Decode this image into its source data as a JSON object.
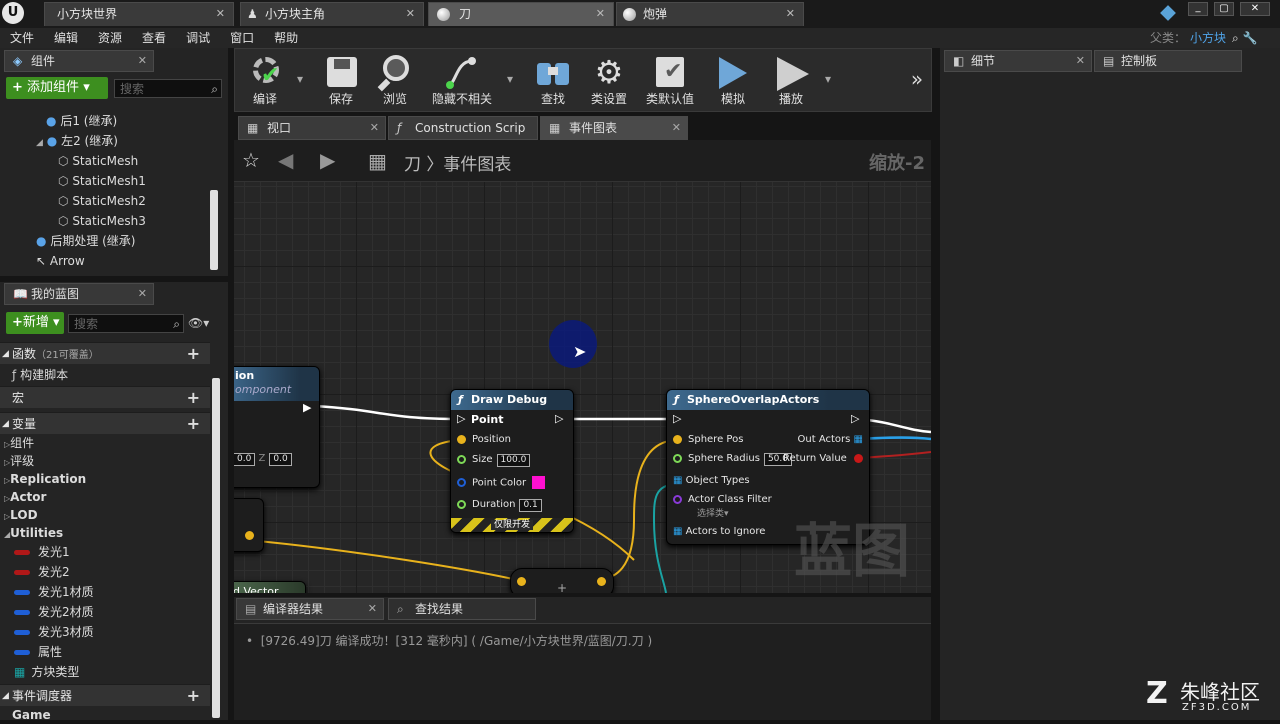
{
  "doc_tabs": [
    {
      "label": "小方块世界",
      "active": false
    },
    {
      "label": "小方块主角",
      "active": false
    },
    {
      "label": "刀",
      "active": true
    },
    {
      "label": "炮弹",
      "active": false
    }
  ],
  "window": {
    "parent_label": "父类：",
    "parent_value": "小方块"
  },
  "menu": [
    "文件",
    "编辑",
    "资源",
    "查看",
    "调试",
    "窗口",
    "帮助"
  ],
  "components": {
    "tab": "组件",
    "add_button": "添加组件",
    "search_placeholder": "搜索",
    "tree": [
      "后1 (继承)",
      "左2 (继承)",
      "StaticMesh",
      "StaticMesh1",
      "StaticMesh2",
      "StaticMesh3",
      "后期处理 (继承)",
      "Arrow"
    ]
  },
  "myblueprint": {
    "tab": "我的蓝图",
    "new_button": "新增",
    "search_placeholder": "搜索",
    "functions_label": "函数",
    "functions_count": "（21可覆盖）",
    "construct_script": "构建脚本",
    "macros_label": "宏",
    "variables_label": "变量",
    "categories": [
      "组件",
      "评级",
      "Replication",
      "Actor",
      "LOD",
      "Utilities"
    ],
    "variables": [
      {
        "name": "发光1",
        "color": "#b01818"
      },
      {
        "name": "发光2",
        "color": "#b01818"
      },
      {
        "name": "发光1材质",
        "color": "#1f5fd6"
      },
      {
        "name": "发光2材质",
        "color": "#1f5fd6"
      },
      {
        "name": "发光3材质",
        "color": "#1f5fd6"
      },
      {
        "name": "属性",
        "color": "#1f5fd6"
      },
      {
        "name": "方块类型",
        "color": "#1aa3a3"
      }
    ],
    "dispatchers_label": "事件调度器",
    "dispatchers_item": "Game"
  },
  "toolbar": [
    "编译",
    "保存",
    "浏览",
    "隐藏不相关",
    "查找",
    "类设置",
    "类默认值",
    "模拟",
    "播放"
  ],
  "editor_tabs": [
    "视口",
    "Construction Scrip",
    "事件图表"
  ],
  "graph": {
    "breadcrumb_root": "刀",
    "breadcrumb_current": "事件图表",
    "zoom": "缩放-2",
    "watermark": "蓝图",
    "left_node": {
      "title": "ion",
      "subtitle": "omponent",
      "x_value": "0.0",
      "z_label": "Z",
      "z_value": "0.0"
    },
    "partial_node_label": "d Vector",
    "draw_debug_point": {
      "title": "Draw Debug Point",
      "position": "Position",
      "size_label": "Size",
      "size_value": "100.0",
      "color_label": "Point Color",
      "duration_label": "Duration",
      "duration_value": "0.1",
      "dev_only": "仅限开发"
    },
    "sphere_overlap": {
      "title": "SphereOverlapActors",
      "sphere_pos": "Sphere Pos",
      "out_actors": "Out Actors",
      "sphere_radius": "Sphere Radius",
      "radius_value": "50.0",
      "return_value": "Return Value",
      "object_types": "Object Types",
      "actor_class_filter": "Actor Class Filter",
      "select_class": "选择类▾",
      "actors_to_ignore": "Actors to Ignore"
    }
  },
  "bottom": {
    "tabs": [
      "编译器结果",
      "查找结果"
    ],
    "log": "[9726.49]刀 编译成功！[312 毫秒内] ( /Game/小方块世界/蓝图/刀.刀 )"
  },
  "right_tabs": [
    "细节",
    "控制板"
  ],
  "brand": {
    "name": "朱峰社区",
    "url": "ZF3D.COM"
  },
  "colors": {
    "accent_green": "#3d8f1f",
    "node_header": "#3e6a8f",
    "exec_wire": "#ffffff",
    "vector_wire": "#e8b21c",
    "array_wire": "#2aa0e8"
  }
}
